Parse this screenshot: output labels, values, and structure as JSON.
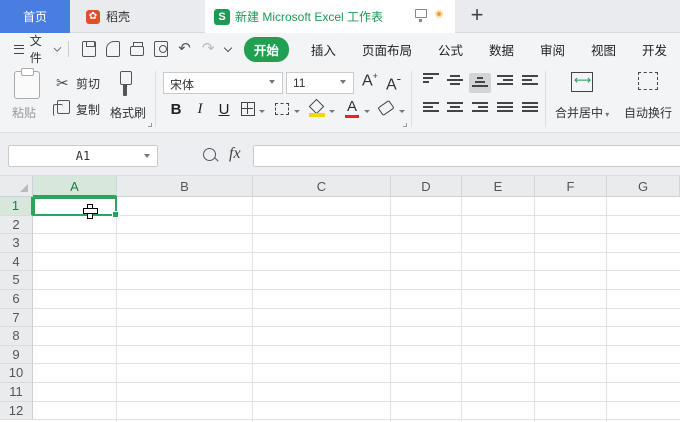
{
  "tabs": {
    "home": "首页",
    "daoke": "稻壳",
    "active": "新建 Microsoft Excel 工作表",
    "active_icon_letter": "S",
    "new_tab": "+"
  },
  "menu": {
    "file": "文件",
    "ribbon_tabs": [
      "开始",
      "插入",
      "页面布局",
      "公式",
      "数据",
      "审阅",
      "视图",
      "开发"
    ]
  },
  "toolbar": {
    "paste": "粘贴",
    "cut": "剪切",
    "copy": "复制",
    "format_painter": "格式刷",
    "font_name": "宋体",
    "font_size": "11",
    "bold": "B",
    "italic": "I",
    "underline": "U",
    "merge_center": "合并居中",
    "wrap_text": "自动换行"
  },
  "formula_bar": {
    "name_box": "A1",
    "fx": "fx",
    "formula": ""
  },
  "sheet": {
    "columns": [
      "A",
      "B",
      "C",
      "D",
      "E",
      "F",
      "G"
    ],
    "rows": [
      "1",
      "2",
      "3",
      "4",
      "5",
      "6",
      "7",
      "8",
      "9",
      "10",
      "11",
      "12"
    ],
    "selected_cell": "A1"
  },
  "colors": {
    "accent_green": "#21a052",
    "home_tab_blue": "#4a7de0"
  }
}
